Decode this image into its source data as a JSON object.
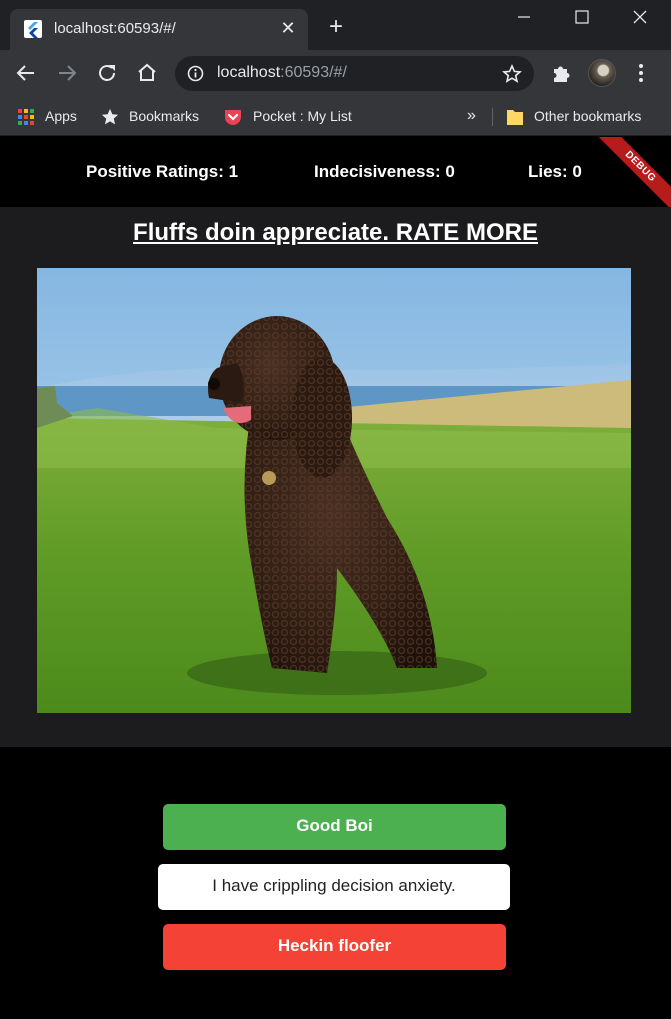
{
  "browser": {
    "tab_title": "localhost:60593/#/",
    "url_host": "localhost",
    "url_rest": ":60593/#/",
    "bookmarks": {
      "apps": "Apps",
      "bookmarks": "Bookmarks",
      "pocket": "Pocket : My List",
      "more": "»",
      "other": "Other bookmarks"
    }
  },
  "app": {
    "stats": {
      "positive": "Positive Ratings: 1",
      "indecisiveness": "Indecisiveness: 0",
      "lies": "Lies: 0"
    },
    "debug_banner": "DEBUG",
    "headline": "Fluffs doin appreciate. RATE MORE",
    "buttons": {
      "good": "Good Boi",
      "unsure": "I have crippling decision anxiety.",
      "floofer": "Heckin floofer"
    }
  },
  "colors": {
    "good": "#4caf50",
    "unsure": "#ffffff",
    "floofer": "#f44336",
    "debug": "#b71c1c"
  }
}
